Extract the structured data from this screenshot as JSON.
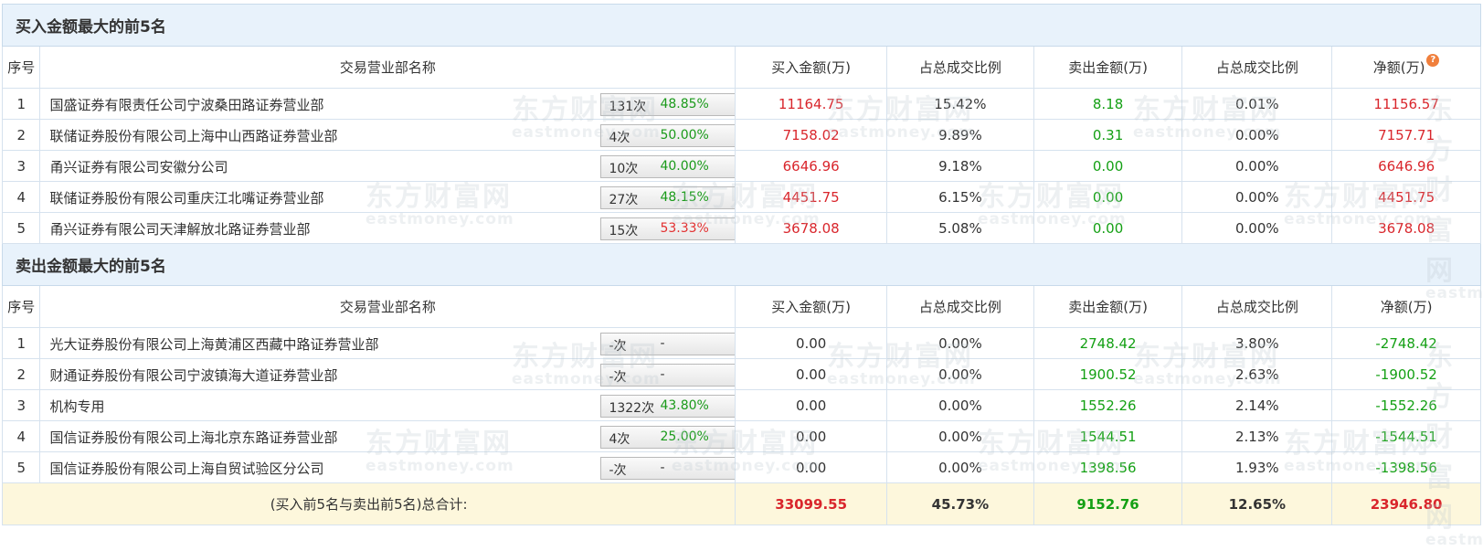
{
  "buy_section": {
    "title": "买入金额最大的前5名",
    "headers": [
      "序号",
      "交易营业部名称",
      "买入金额(万)",
      "占总成交比例",
      "卖出金额(万)",
      "占总成交比例",
      "净额(万)"
    ],
    "rows": [
      {
        "idx": "1",
        "name": "国盛证券有限责任公司宁波桑田路证券营业部",
        "count": "131次",
        "rate": "48.85%",
        "rate_color": "green",
        "icon": "question-icon",
        "buy": "11164.75",
        "buy_pct": "15.42%",
        "sell": "8.18",
        "sell_pct": "0.01%",
        "net": "11156.57"
      },
      {
        "idx": "2",
        "name": "联储证券股份有限公司上海中山西路证券营业部",
        "count": "4次",
        "rate": "50.00%",
        "rate_color": "green",
        "icon": "arrow-right-icon",
        "buy": "7158.02",
        "buy_pct": "9.89%",
        "sell": "0.31",
        "sell_pct": "0.00%",
        "net": "7157.71"
      },
      {
        "idx": "3",
        "name": "甬兴证券有限公司安徽分公司",
        "count": "10次",
        "rate": "40.00%",
        "rate_color": "green",
        "icon": "arrow-right-icon",
        "buy": "6646.96",
        "buy_pct": "9.18%",
        "sell": "0.00",
        "sell_pct": "0.00%",
        "net": "6646.96"
      },
      {
        "idx": "4",
        "name": "联储证券股份有限公司重庆江北嘴证券营业部",
        "count": "27次",
        "rate": "48.15%",
        "rate_color": "green",
        "icon": "arrow-right-icon",
        "buy": "4451.75",
        "buy_pct": "6.15%",
        "sell": "0.00",
        "sell_pct": "0.00%",
        "net": "4451.75"
      },
      {
        "idx": "5",
        "name": "甬兴证券有限公司天津解放北路证券营业部",
        "count": "15次",
        "rate": "53.33%",
        "rate_color": "red",
        "icon": "arrow-right-icon",
        "buy": "3678.08",
        "buy_pct": "5.08%",
        "sell": "0.00",
        "sell_pct": "0.00%",
        "net": "3678.08"
      }
    ]
  },
  "sell_section": {
    "title": "卖出金额最大的前5名",
    "headers": [
      "序号",
      "交易营业部名称",
      "买入金额(万)",
      "占总成交比例",
      "卖出金额(万)",
      "占总成交比例",
      "净额(万)"
    ],
    "rows": [
      {
        "idx": "1",
        "name": "光大证券股份有限公司上海黄浦区西藏中路证券营业部",
        "count": "-次",
        "rate": "-",
        "rate_color": "gray",
        "icon": "question-icon",
        "buy": "0.00",
        "buy_pct": "0.00%",
        "sell": "2748.42",
        "sell_pct": "3.80%",
        "net": "-2748.42"
      },
      {
        "idx": "2",
        "name": "财通证券股份有限公司宁波镇海大道证券营业部",
        "count": "-次",
        "rate": "-",
        "rate_color": "gray",
        "icon": "arrow-right-icon",
        "buy": "0.00",
        "buy_pct": "0.00%",
        "sell": "1900.52",
        "sell_pct": "2.63%",
        "net": "-1900.52"
      },
      {
        "idx": "3",
        "name": "机构专用",
        "count": "1322次",
        "rate": "43.80%",
        "rate_color": "green",
        "icon": "arrow-right-icon",
        "buy": "0.00",
        "buy_pct": "0.00%",
        "sell": "1552.26",
        "sell_pct": "2.14%",
        "net": "-1552.26"
      },
      {
        "idx": "4",
        "name": "国信证券股份有限公司上海北京东路证券营业部",
        "count": "4次",
        "rate": "25.00%",
        "rate_color": "green",
        "icon": "arrow-right-icon",
        "buy": "0.00",
        "buy_pct": "0.00%",
        "sell": "1544.51",
        "sell_pct": "2.13%",
        "net": "-1544.51"
      },
      {
        "idx": "5",
        "name": "国信证券股份有限公司上海自贸试验区分公司",
        "count": "-次",
        "rate": "-",
        "rate_color": "gray",
        "icon": "arrow-right-icon",
        "buy": "0.00",
        "buy_pct": "0.00%",
        "sell": "1398.56",
        "sell_pct": "1.93%",
        "net": "-1398.56"
      }
    ]
  },
  "total": {
    "label": "(买入前5名与卖出前5名)总合计:",
    "buy": "33099.55",
    "buy_pct": "45.73%",
    "sell": "9152.76",
    "sell_pct": "12.65%",
    "net": "23946.80"
  },
  "watermark": {
    "cn": "东方财富网",
    "en": "eastmoney.com"
  },
  "colors": {
    "positive": "#d9262c",
    "negative": "#14a014",
    "header_bg": "#e8f2fb",
    "total_bg": "#fdf7dc",
    "border": "#d6e2ee"
  }
}
